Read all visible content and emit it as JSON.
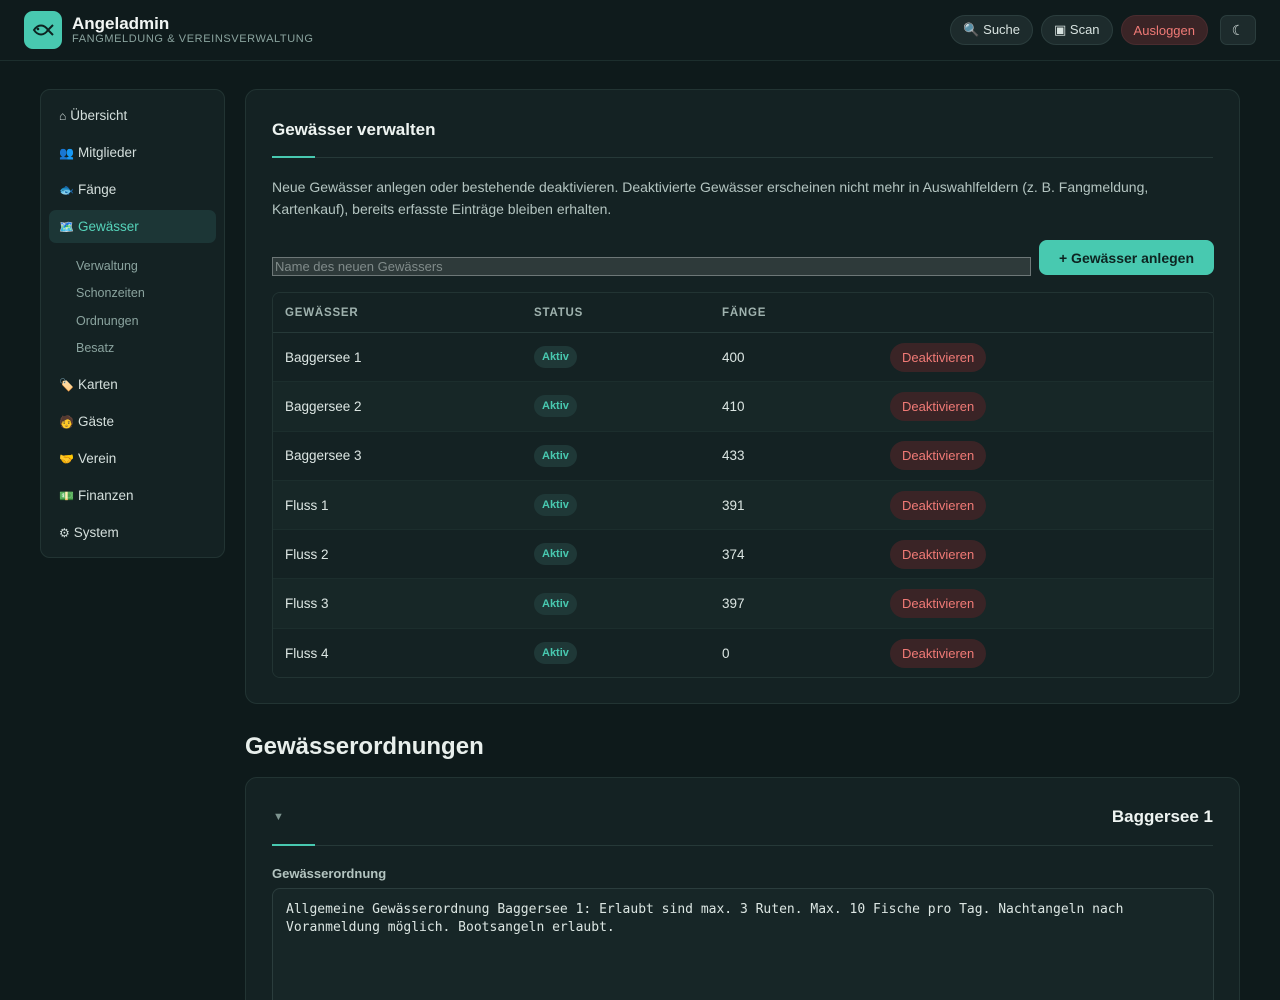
{
  "header": {
    "title": "Angeladmin",
    "subtitle": "Fangmeldung & Vereinsverwaltung",
    "search_label": "🔍 Suche",
    "scan_label": "▣ Scan",
    "logout_label": "Ausloggen",
    "theme_icon": "☾"
  },
  "sidebar": {
    "items": [
      {
        "icon": "⌂",
        "label": "Übersicht"
      },
      {
        "icon": "👥",
        "label": "Mitglieder"
      },
      {
        "icon": "🐟",
        "label": "Fänge"
      },
      {
        "icon": "🗺️",
        "label": "Gewässer"
      },
      {
        "icon": "🏷️",
        "label": "Karten"
      },
      {
        "icon": "🧑",
        "label": "Gäste"
      },
      {
        "icon": "🤝",
        "label": "Verein"
      },
      {
        "icon": "💵",
        "label": "Finanzen"
      },
      {
        "icon": "⚙",
        "label": "System"
      }
    ],
    "subitems": [
      "Verwaltung",
      "Schonzeiten",
      "Ordnungen",
      "Besatz"
    ]
  },
  "manage": {
    "title": "Gewässer verwalten",
    "description": "Neue Gewässer anlegen oder bestehende deaktivieren. Deaktivierte Gewässer erscheinen nicht mehr in Auswahlfeldern (z. B. Fangmeldung, Kartenkauf), bereits erfasste Einträge bleiben erhalten.",
    "input_placeholder": "Name des neuen Gewässers",
    "add_label": "+ Gewässer anlegen",
    "columns": [
      "GEWÄSSER",
      "STATUS",
      "FÄNGE"
    ],
    "rows": [
      {
        "name": "Baggersee 1",
        "status": "Aktiv",
        "catches": "400",
        "action": "Deaktivieren"
      },
      {
        "name": "Baggersee 2",
        "status": "Aktiv",
        "catches": "410",
        "action": "Deaktivieren"
      },
      {
        "name": "Baggersee 3",
        "status": "Aktiv",
        "catches": "433",
        "action": "Deaktivieren"
      },
      {
        "name": "Fluss 1",
        "status": "Aktiv",
        "catches": "391",
        "action": "Deaktivieren"
      },
      {
        "name": "Fluss 2",
        "status": "Aktiv",
        "catches": "374",
        "action": "Deaktivieren"
      },
      {
        "name": "Fluss 3",
        "status": "Aktiv",
        "catches": "397",
        "action": "Deaktivieren"
      },
      {
        "name": "Fluss 4",
        "status": "Aktiv",
        "catches": "0",
        "action": "Deaktivieren"
      }
    ]
  },
  "rules": {
    "section_title": "Gewässerordnungen",
    "toggle_icon": "▼",
    "water_name": "Baggersee 1",
    "field_label": "Gewässerordnung",
    "text": "Allgemeine Gewässerordnung Baggersee 1: Erlaubt sind max. 3 Ruten. Max. 10 Fische pro Tag. Nachtangeln nach Voranmeldung möglich. Bootsangeln erlaubt."
  },
  "colors": {
    "accent": "#48c9b0",
    "background": "#0e1a1b",
    "danger": "#f07a76"
  }
}
